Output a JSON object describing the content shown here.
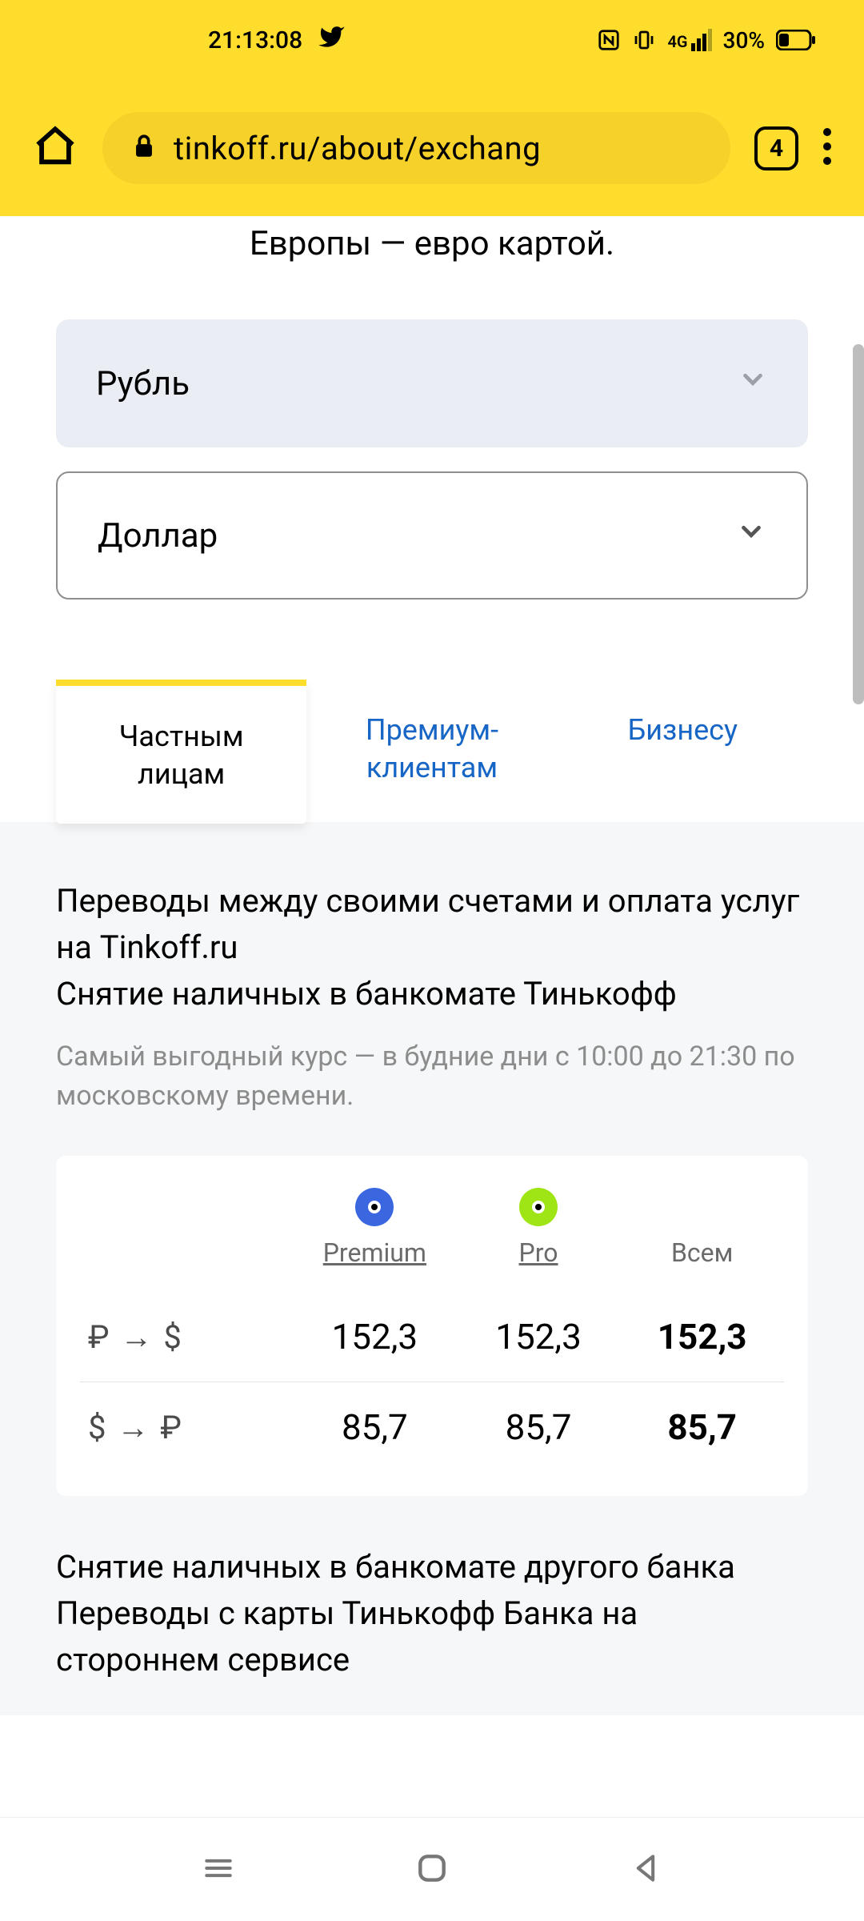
{
  "status": {
    "time": "21:13:08",
    "battery": "30%",
    "net": "4G"
  },
  "browser": {
    "url": "tinkoff.ru/about/exchang",
    "tab_count": "4"
  },
  "page": {
    "top_text": "Европы — евро картой.",
    "from_currency": "Рубль",
    "to_currency": "Доллар",
    "tabs": {
      "individuals": "Частным\nлицам",
      "premium": "Премиум-\nклиентам",
      "business": "Бизнесу"
    },
    "panel_title": "Переводы между своими счетами и оплата услуг на Tinkoff.ru\nСнятие наличных в банкомате Тинькофф",
    "panel_sub": "Самый выгодный курс — в будние дни с 10:00 до 21:30 по московскому времени.",
    "cols": {
      "premium": "Premium",
      "pro": "Pro",
      "all": "Всем"
    },
    "rows": [
      {
        "pair": "₽  →  $",
        "premium": "152,3",
        "pro": "152,3",
        "all": "152,3"
      },
      {
        "pair": "$  →  ₽",
        "premium": "85,7",
        "pro": "85,7",
        "all": "85,7"
      }
    ],
    "footer_text": "Снятие наличных в банкомате другого банка Переводы с карты Тинькофф Банка на стороннем сервисе"
  }
}
